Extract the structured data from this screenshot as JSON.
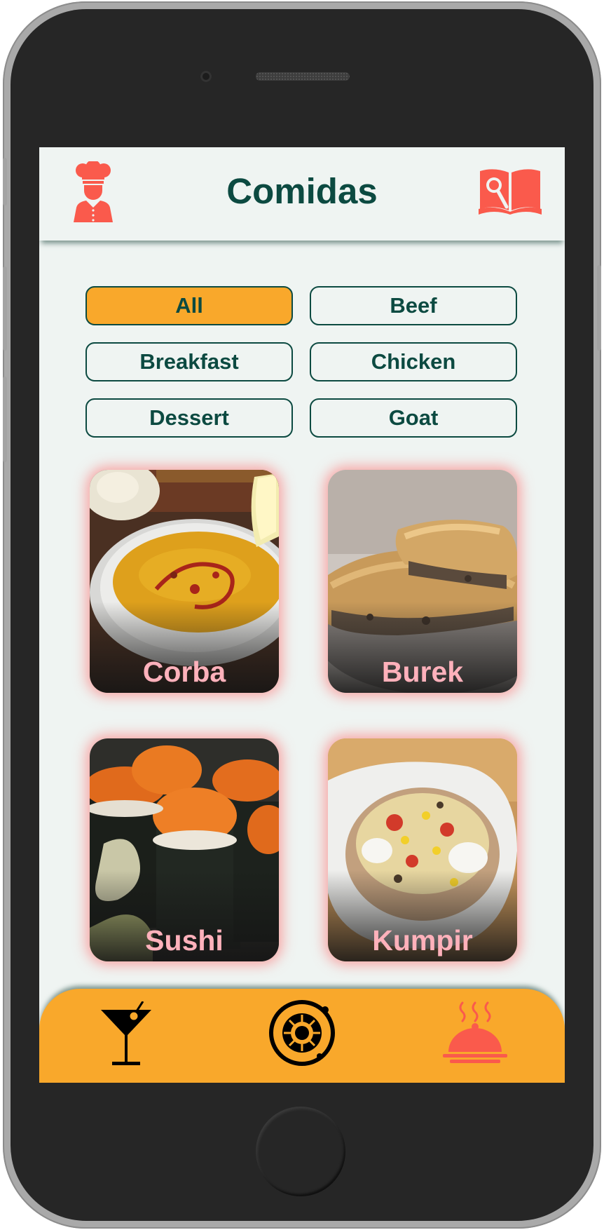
{
  "header": {
    "title": "Comidas",
    "left_icon": "chef-icon",
    "right_icon": "recipe-book-icon"
  },
  "filters": {
    "selected": "All",
    "items": [
      "All",
      "Beef",
      "Breakfast",
      "Chicken",
      "Dessert",
      "Goat"
    ]
  },
  "meals": [
    {
      "name": "Corba",
      "image": "lentil-soup-photo"
    },
    {
      "name": "Burek",
      "image": "meat-pastry-photo"
    },
    {
      "name": "Sushi",
      "image": "sushi-rolls-photo"
    },
    {
      "name": "Kumpir",
      "image": "stuffed-potato-photo"
    }
  ],
  "bottom_nav": {
    "selected": "food",
    "items": [
      {
        "id": "drinks",
        "icon": "cocktail-icon"
      },
      {
        "id": "explore",
        "icon": "explore-icon"
      },
      {
        "id": "food",
        "icon": "food-dish-icon"
      }
    ]
  },
  "colors": {
    "primary": "#0c4a41",
    "accent": "#f9a82b",
    "icon_red": "#fa5a4c",
    "meal_label": "#ffb1bb",
    "background": "#eff4f2",
    "phone_body": "#262626"
  }
}
